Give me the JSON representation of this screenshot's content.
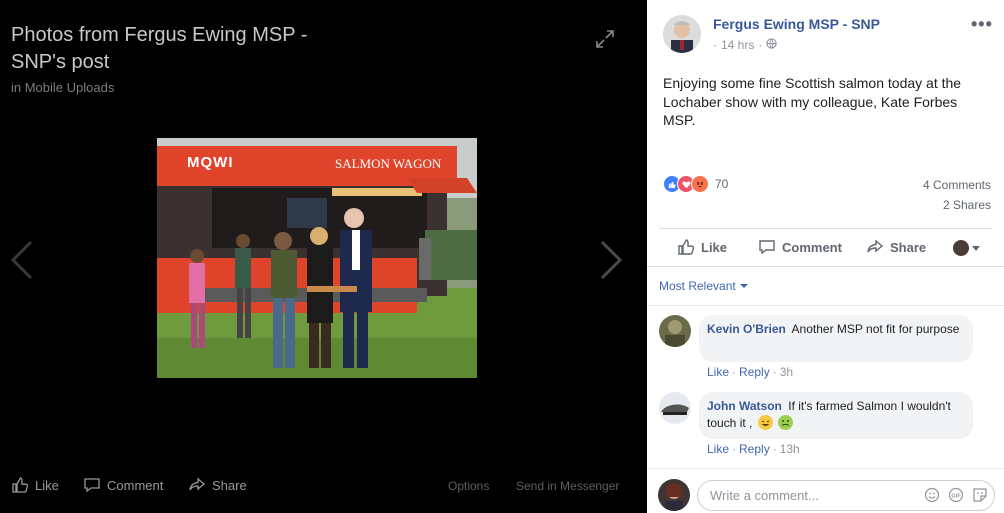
{
  "viewer": {
    "title": "Photos from Fergus Ewing MSP - SNP's post",
    "album": "in Mobile Uploads",
    "photo": {
      "sign_brand": "MQWI",
      "sign_text": "SALMON WAGON"
    },
    "actions": {
      "like": "Like",
      "comment": "Comment",
      "share": "Share",
      "options": "Options",
      "send": "Send in Messenger"
    }
  },
  "post": {
    "author": "Fergus Ewing MSP - SNP",
    "time": "14 hrs",
    "more_icon": "more-icon",
    "text": "Enjoying some fine Scottish salmon today at the Lochaber show with my colleague, Kate Forbes MSP.",
    "reactions": {
      "count": "70",
      "types": [
        "like",
        "love",
        "angry"
      ],
      "colors": {
        "like": "#4080ff",
        "love": "#f25268",
        "angry": "#f7714c"
      }
    },
    "comments_count": "4 Comments",
    "shares_count": "2 Shares",
    "actions": {
      "like": "Like",
      "comment": "Comment",
      "share": "Share"
    },
    "sort_label": "Most Relevant",
    "comments": [
      {
        "name": "Kevin O'Brien",
        "text": "Another MSP not fit for purpose",
        "like": "Like",
        "reply": "Reply",
        "time": "3h"
      },
      {
        "name": "John Watson",
        "text": "If it's farmed Salmon I wouldn't touch it ,",
        "like": "Like",
        "reply": "Reply",
        "time": "13h"
      }
    ],
    "composer_placeholder": "Write a comment..."
  },
  "colors": {
    "link_blue": "#385898",
    "action_blue": "#4267b2",
    "grey_text": "#606770"
  }
}
